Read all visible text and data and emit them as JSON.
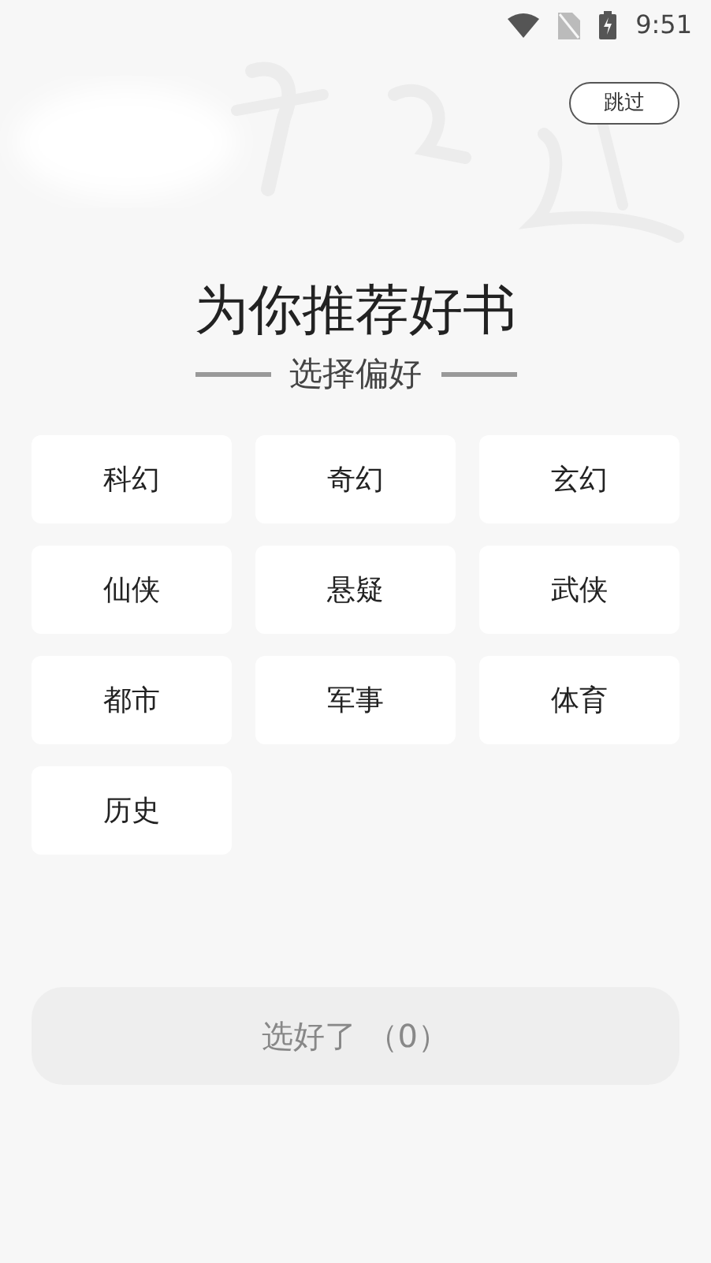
{
  "status_bar": {
    "time": "9:51"
  },
  "skip_button": {
    "label": "跳过"
  },
  "title": "为你推荐好书",
  "subtitle": "选择偏好",
  "genres": [
    {
      "label": "科幻",
      "selected": false
    },
    {
      "label": "奇幻",
      "selected": false
    },
    {
      "label": "玄幻",
      "selected": false
    },
    {
      "label": "仙侠",
      "selected": false
    },
    {
      "label": "悬疑",
      "selected": false
    },
    {
      "label": "武侠",
      "selected": false
    },
    {
      "label": "都市",
      "selected": false
    },
    {
      "label": "军事",
      "selected": false
    },
    {
      "label": "体育",
      "selected": false
    },
    {
      "label": "历史",
      "selected": false
    }
  ],
  "confirm_button": {
    "label": "选好了 （0）",
    "disabled": true
  }
}
